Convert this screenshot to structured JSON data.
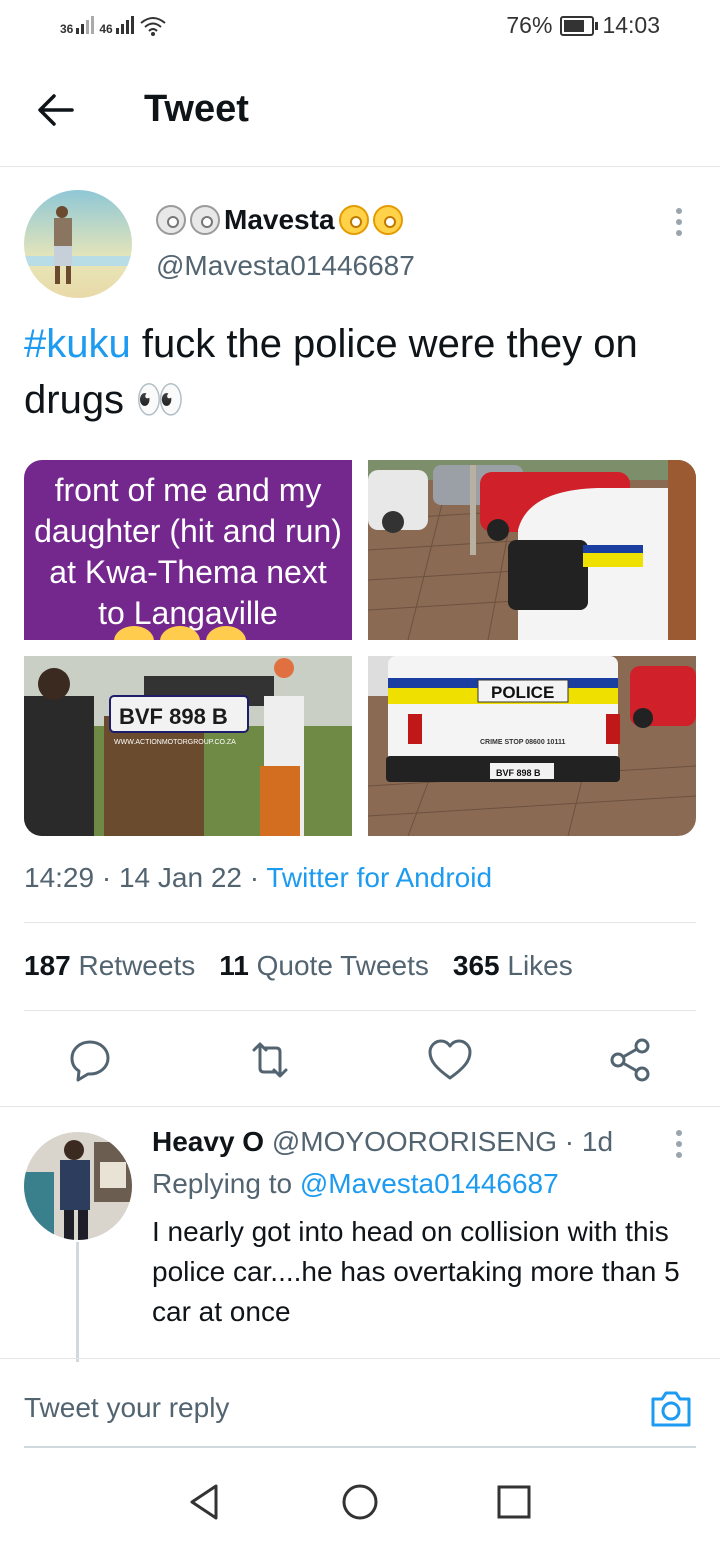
{
  "status_bar": {
    "signal1": "36",
    "signal2": "46",
    "battery": "76%",
    "time": "14:03"
  },
  "header": {
    "title": "Tweet"
  },
  "tweet": {
    "display_name": "Mavesta",
    "handle": "@Mavesta01446687",
    "hashtag": "#kuku",
    "text": " fuck the police were they on drugs 👀",
    "image1_text": "front of me and my daughter (hit and run) at Kwa-Thema next to Langaville",
    "image3_plate": "BVF 898 B",
    "image3_url": "WWW.ACTIONMOTORGROUP.CO.ZA",
    "image4_police": "POLICE",
    "image4_crime": "CRIME STOP 08600 10111",
    "image4_plate": "BVF 898 B",
    "time": "14:29",
    "date": "14 Jan 22",
    "source": "Twitter for Android",
    "retweets_count": "187",
    "retweets_label": "Retweets",
    "quotes_count": "11",
    "quotes_label": "Quote Tweets",
    "likes_count": "365",
    "likes_label": "Likes"
  },
  "reply": {
    "name": "Heavy O",
    "handle": "@MOYOORORISENG",
    "age": "1d",
    "replying_prefix": "Replying to",
    "replying_to": "@Mavesta01446687",
    "text": "I nearly got into head on collision with this police car....he has overtaking more than 5 car at once"
  },
  "reply_box": {
    "placeholder": "Tweet your reply"
  },
  "colors": {
    "accent": "#1d9bf0",
    "purple": "#74288e",
    "secondary": "#536471"
  },
  "icons": [
    "back-arrow-icon",
    "reply-icon",
    "retweet-icon",
    "like-icon",
    "share-icon",
    "camera-icon",
    "nav-back-icon",
    "nav-home-icon",
    "nav-recents-icon"
  ]
}
